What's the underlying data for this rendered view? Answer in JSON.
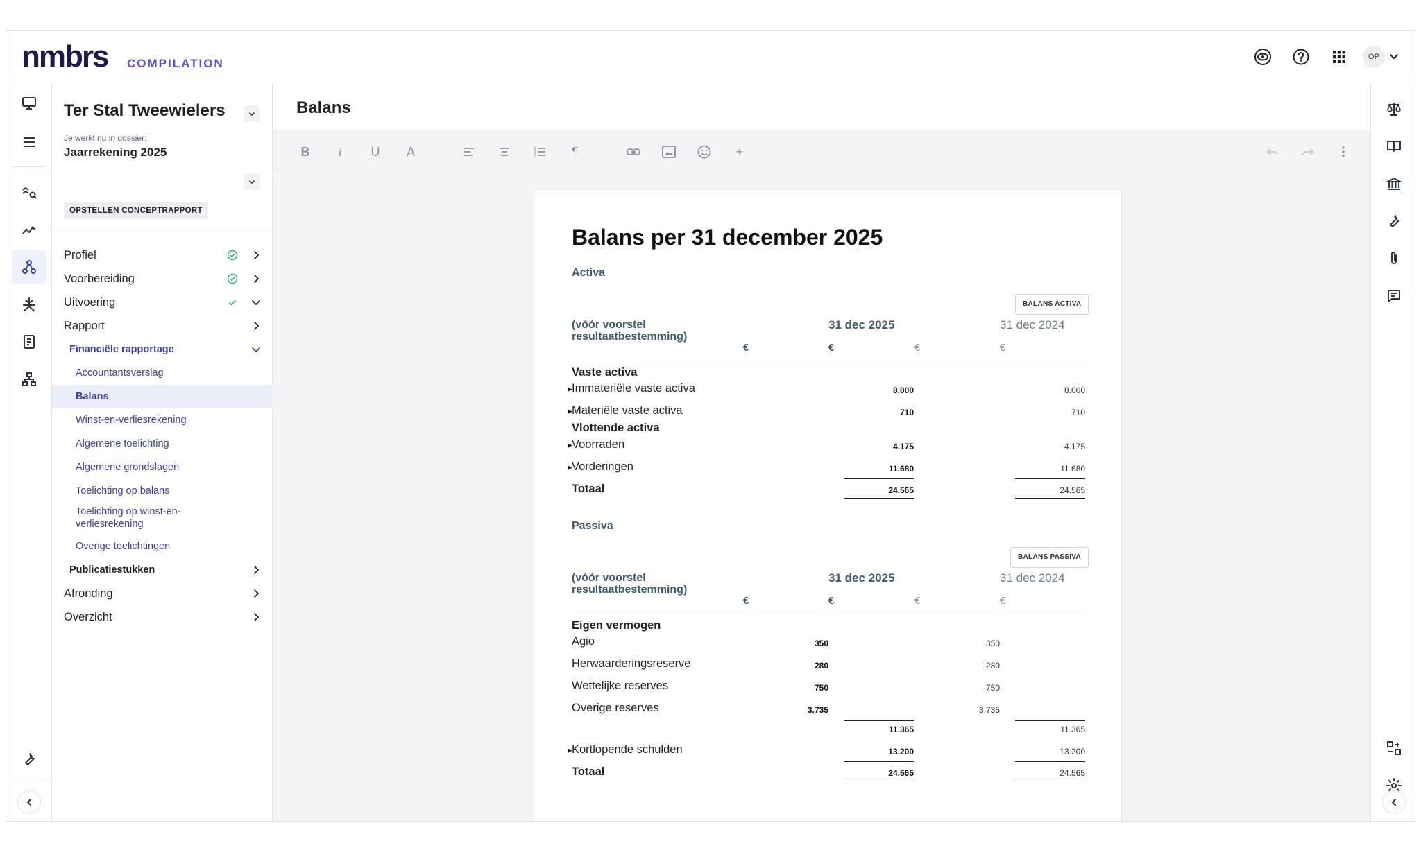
{
  "brand": {
    "logo": "nmbrs",
    "product": "COMPILATION"
  },
  "user": {
    "initials": "OP"
  },
  "client": {
    "name": "Ter Stal Tweewielers"
  },
  "dossier": {
    "label": "Je werkt nu in dossier:",
    "value": "Jaarrekening 2025",
    "status": "OPSTELLEN CONCEPTRAPPORT"
  },
  "nav": {
    "profiel": "Profiel",
    "voorbereiding": "Voorbereiding",
    "uitvoering": "Uitvoering",
    "rapport": "Rapport",
    "financiele_rapportage": "Financiële rapportage",
    "accountantsverslag": "Accountantsverslag",
    "balans": "Balans",
    "winst_verlies": "Winst-en-verliesrekening",
    "algemene_toelichting": "Algemene toelichting",
    "algemene_grondslagen": "Algemene grondslagen",
    "toelichting_balans": "Toelichting op balans",
    "toelichting_wv": "Toelichting op winst-en-verliesrekening",
    "overige_toelichtingen": "Overige toelichtingen",
    "publicatiestukken": "Publicatiestukken",
    "afronding": "Afronding",
    "overzicht": "Overzicht"
  },
  "editor": {
    "title": "Balans"
  },
  "toolbar": {
    "bold": "B",
    "italic": "i",
    "underline": "U",
    "fontsize": "A",
    "paragraph": "¶",
    "insert": "+"
  },
  "document": {
    "title": "Balans per 31 december 2025",
    "activa": {
      "heading": "Activa",
      "tag": "BALANS ACTIVA",
      "col_header": "(vóór voorstel resultaatbestemming)",
      "date_current": "31 dec 2025",
      "date_prior": "31 dec 2024",
      "currency": "€",
      "vaste_activa": "Vaste activa",
      "immaterieel": {
        "label": "Immateriële vaste activa",
        "cur": "8.000",
        "prior": "8.000"
      },
      "materieel": {
        "label": "Materiële vaste activa",
        "cur": "710",
        "prior": "710"
      },
      "vlottende_activa": "Vlottende activa",
      "voorraden": {
        "label": "Voorraden",
        "cur": "4.175",
        "prior": "4.175"
      },
      "vorderingen": {
        "label": "Vorderingen",
        "cur": "11.680",
        "prior": "11.680"
      },
      "totaal": {
        "label": "Totaal",
        "cur": "24.565",
        "prior": "24.565"
      }
    },
    "passiva": {
      "heading": "Passiva",
      "tag": "BALANS PASSIVA",
      "col_header": "(vóór voorstel resultaatbestemming)",
      "date_current": "31 dec 2025",
      "date_prior": "31 dec 2024",
      "currency": "€",
      "eigen_vermogen": "Eigen vermogen",
      "agio": {
        "label": "Agio",
        "cur": "350",
        "prior": "350"
      },
      "herwaardering": {
        "label": "Herwaarderingsreserve",
        "cur": "280",
        "prior": "280"
      },
      "wettelijke": {
        "label": "Wettelijke reserves",
        "cur": "750",
        "prior": "750"
      },
      "overige": {
        "label": "Overige reserves",
        "cur": "3.735",
        "prior": "3.735"
      },
      "subtotaal": {
        "cur": "11.365",
        "prior": "11.365"
      },
      "kortlopend": {
        "label": "Kortlopende schulden",
        "cur": "13.200",
        "prior": "13.200"
      },
      "totaal": {
        "label": "Totaal",
        "cur": "24.565",
        "prior": "24.565"
      }
    }
  }
}
